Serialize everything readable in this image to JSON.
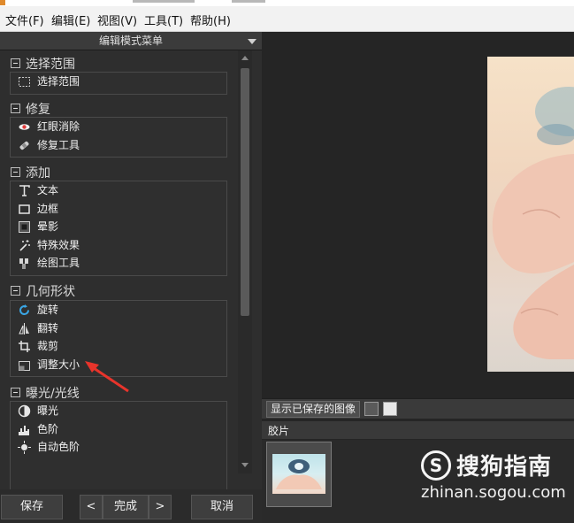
{
  "menu": {
    "file": "文件(F)",
    "edit": "编辑(E)",
    "view": "视图(V)",
    "tools": "工具(T)",
    "help": "帮助(H)"
  },
  "panel": {
    "title": "编辑模式菜单"
  },
  "sections": {
    "select": {
      "title": "选择范围",
      "items": [
        "选择范围"
      ]
    },
    "repair": {
      "title": "修复",
      "items": [
        "红眼消除",
        "修复工具"
      ]
    },
    "add": {
      "title": "添加",
      "items": [
        "文本",
        "边框",
        "晕影",
        "特殊效果",
        "绘图工具"
      ]
    },
    "geometry": {
      "title": "几何形状",
      "items": [
        "旋转",
        "翻转",
        "裁剪",
        "调整大小"
      ]
    },
    "exposure": {
      "title": "曝光/光线",
      "items": [
        "曝光",
        "色阶",
        "自动色阶"
      ]
    }
  },
  "buttons": {
    "save": "保存",
    "prev": "<",
    "done": "完成",
    "next": ">",
    "cancel": "取消"
  },
  "viewer": {
    "show_saved_label": "显示已保存的图像",
    "filmstrip_label": "胶片"
  },
  "watermark": {
    "brand": "搜狗指南",
    "url": "zhinan.sogou.com"
  },
  "colors": {
    "panel_bg": "#2e2e2e",
    "menubar_bg": "#f2f2f2",
    "annotation_arrow": "#e8342b",
    "rotate_icon": "#3aa7e6",
    "redeye_icon": "#e03a3a"
  }
}
